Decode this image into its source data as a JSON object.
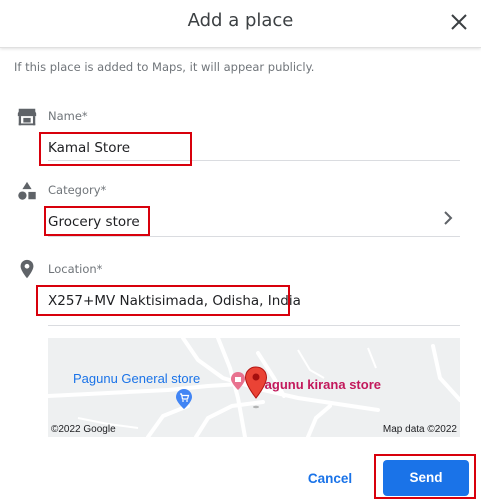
{
  "dialog": {
    "title": "Add a place",
    "notice": "If this place is added to Maps, it will appear publicly."
  },
  "fields": {
    "name": {
      "label": "Name*",
      "value": "Kamal Store",
      "icon": "store-icon"
    },
    "category": {
      "label": "Category*",
      "value": "Grocery store",
      "icon": "category-shapes-icon"
    },
    "location": {
      "label": "Location*",
      "value": "X257+MV Naktisimada, Odisha, India",
      "icon": "location-pin-icon"
    }
  },
  "map": {
    "place_general": "Pagunu General store",
    "place_kirana": "Pagunu kirana store",
    "attribution_left": "©2022 Google",
    "attribution_right": "Map data ©2022",
    "colors": {
      "general_label": "#1a73e8",
      "kirana_label": "#c2185b",
      "pin": "#ea4335"
    }
  },
  "actions": {
    "cancel": "Cancel",
    "send": "Send"
  },
  "colors": {
    "accent": "#1a73e8",
    "highlight_box": "#d8000c"
  }
}
